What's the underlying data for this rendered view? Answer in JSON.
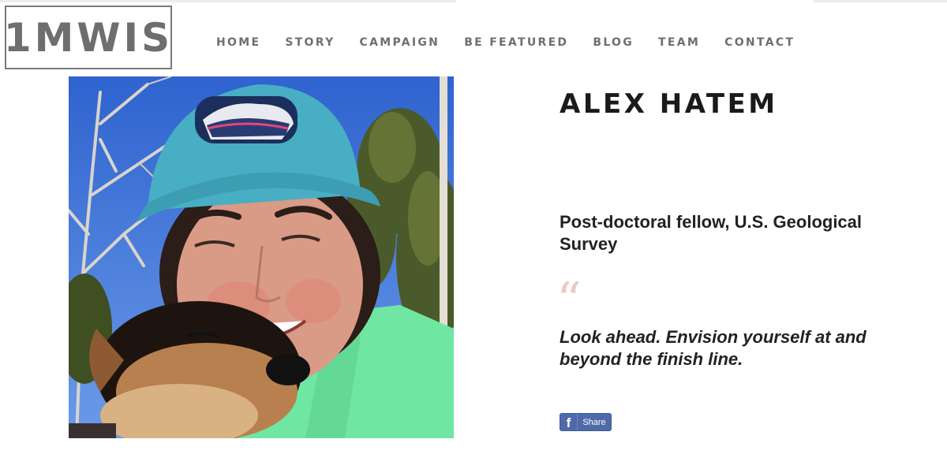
{
  "site": {
    "logo_text": "1MWIS"
  },
  "nav": {
    "items": [
      {
        "label": "HOME"
      },
      {
        "label": "STORY"
      },
      {
        "label": "CAMPAIGN"
      },
      {
        "label": "BE FEATURED"
      },
      {
        "label": "BLOG"
      },
      {
        "label": "TEAM"
      },
      {
        "label": "CONTACT"
      }
    ]
  },
  "profile": {
    "name": "ALEX HATEM",
    "role": "Post-doctoral fellow, U.S. Geological Survey",
    "quote_mark": "“",
    "quote": "Look ahead. Envision yourself at and beyond the finish line."
  },
  "share": {
    "icon": "facebook-icon",
    "glyph": "f",
    "label": "Share"
  },
  "colors": {
    "nav_text": "#6f6f6f",
    "logo": "#6e6e6e",
    "quote_mark": "#eec8c8",
    "share_bg": "#4f6aa8"
  }
}
